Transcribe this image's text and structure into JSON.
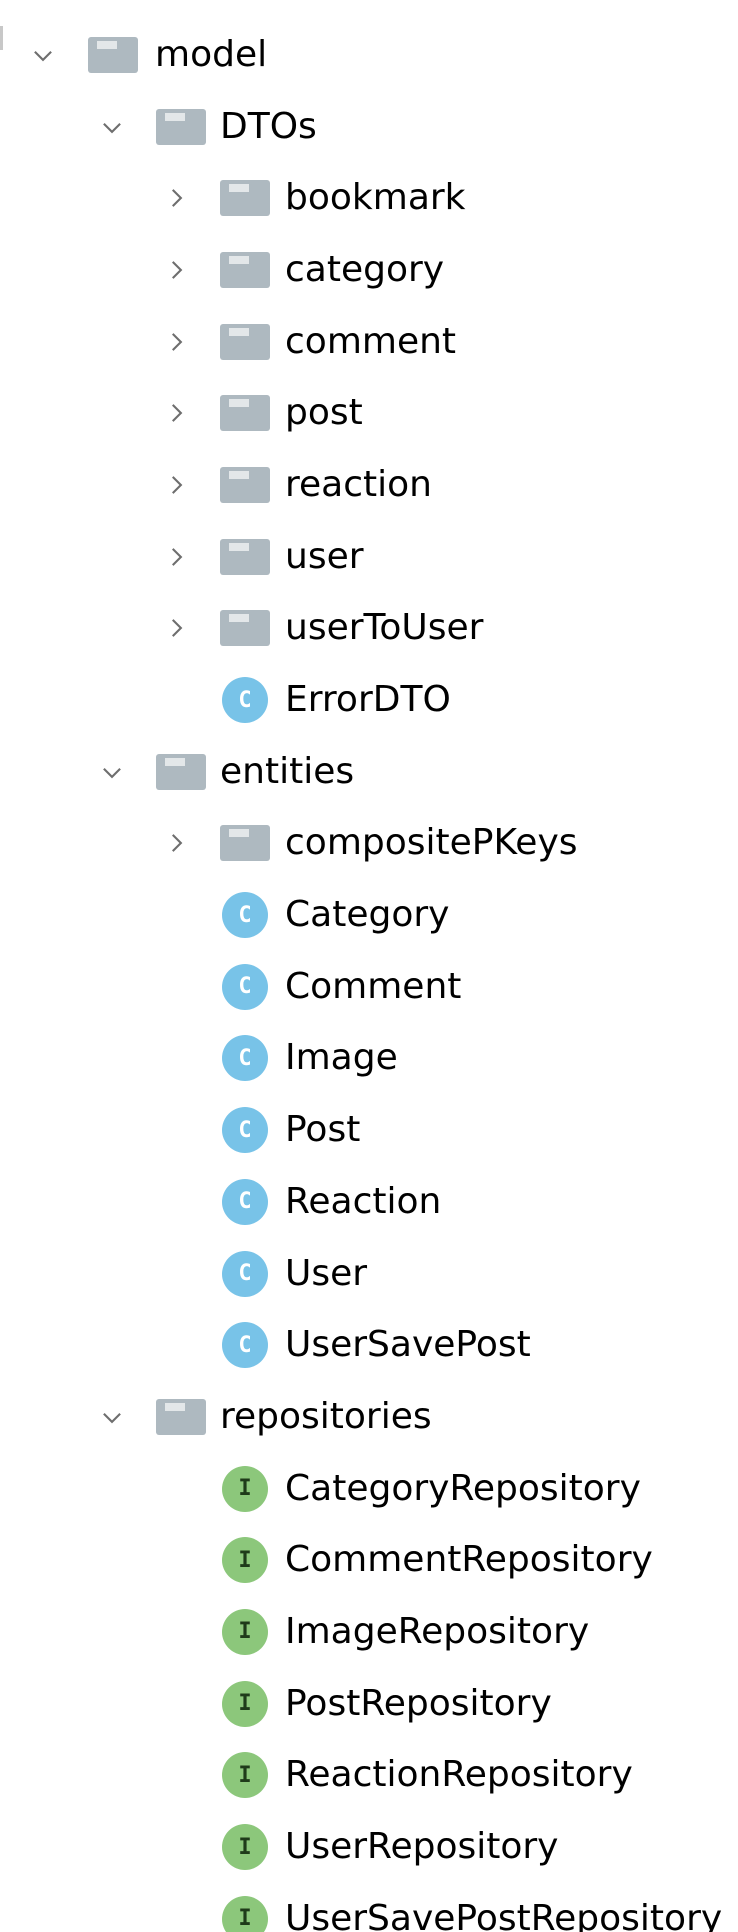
{
  "tree": {
    "root": {
      "label": "model",
      "expanded": true
    },
    "dtos": {
      "label": "DTOs",
      "expanded": true,
      "folders": [
        "bookmark",
        "category",
        "comment",
        "post",
        "reaction",
        "user",
        "userToUser"
      ],
      "classes": [
        "ErrorDTO"
      ]
    },
    "entities": {
      "label": "entities",
      "expanded": true,
      "folders": [
        "compositePKeys"
      ],
      "classes": [
        "Category",
        "Comment",
        "Image",
        "Post",
        "Reaction",
        "User",
        "UserSavePost"
      ]
    },
    "repositories": {
      "label": "repositories",
      "expanded": true,
      "interfaces": [
        "CategoryRepository",
        "CommentRepository",
        "ImageRepository",
        "PostRepository",
        "ReactionRepository",
        "UserRepository",
        "UserSavePostRepository"
      ]
    }
  },
  "icons": {
    "folder": "folder-icon",
    "class": "class-icon",
    "interface": "interface-icon",
    "expanded": "chevron-down-icon",
    "collapsed": "chevron-right-icon",
    "class_badge_letter": "C",
    "interface_badge_letter": "I"
  },
  "colors": {
    "folder": "#aeb9c0",
    "class_badge": "#78c3e8",
    "interface_badge": "#8cc77b",
    "chevron": "#6e6e6e",
    "text": "#000000"
  }
}
